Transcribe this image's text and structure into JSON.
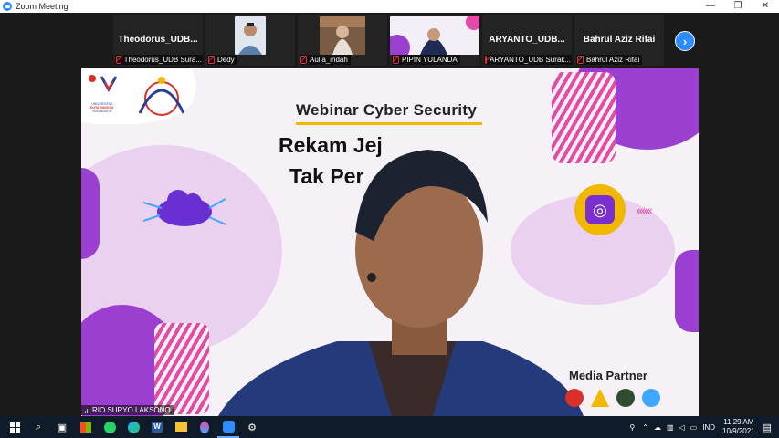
{
  "window": {
    "title": "Zoom Meeting",
    "controls": [
      "—",
      "❐",
      "✕"
    ]
  },
  "participants": [
    {
      "big_name": "Theodorus_UDB...",
      "label": "Theodorus_UDB Sura...",
      "video": false
    },
    {
      "big_name": "",
      "label": "Dedy",
      "video": true
    },
    {
      "big_name": "",
      "label": "Aulia_indah",
      "video": true
    },
    {
      "big_name": "",
      "label": "PIPIN YULANDA",
      "video": true
    },
    {
      "big_name": "ARYANTO_UDB...",
      "label": "ARYANTO_UDB Surak...",
      "video": false
    },
    {
      "big_name": "Bahrul Aziz Rifai",
      "label": "Bahrul Aziz Rifai",
      "video": false
    }
  ],
  "next_symbol": "›",
  "slide": {
    "heading": "Webinar Cyber Security",
    "line1": "Rekam Jej",
    "line2": "Tak Per",
    "media_partner": "Media Partner",
    "uni_lines": [
      "UNIVERSITAS",
      "DUTA BANGSA",
      "SURAKARTA"
    ]
  },
  "speaker_name": "RIO SURYO LAKSONO",
  "colors": {
    "accent": "#2d8cff",
    "purple": "#9b3fd1",
    "pink": "#e44aa7",
    "yellow": "#f0b800"
  },
  "taskbar": {
    "icons": [
      "windows-icon",
      "search-icon",
      "task-view-icon",
      "store-icon",
      "whatsapp-icon",
      "edge-icon",
      "word-icon",
      "explorer-icon",
      "paint-icon",
      "zoom-icon",
      "settings-icon"
    ],
    "time": "11:29 AM",
    "date": "10/9/2021",
    "lang": "IND"
  }
}
